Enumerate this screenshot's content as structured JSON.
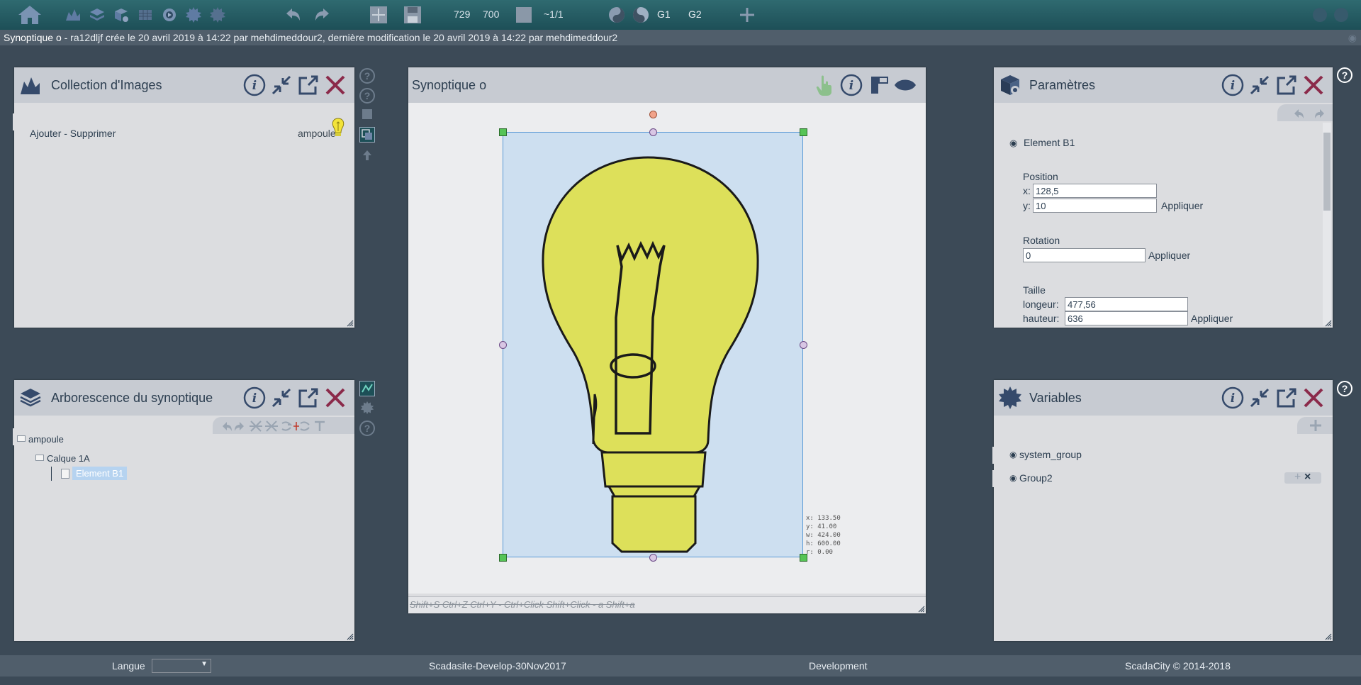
{
  "topbar": {
    "num1": "729",
    "num2": "700",
    "page": "~1/1",
    "g1": "G1",
    "g2": "G2"
  },
  "infobar": {
    "title": "Synoptique o",
    "meta": " - ra12dljf crée le 20 avril 2019 à 14:22 par mehdimeddour2, dernière modification le 20 avril 2019 à 14:22 par mehdimeddour2"
  },
  "collection": {
    "title": "Collection d'Images",
    "add_remove": "Ajouter - Supprimer",
    "item_name": "ampoule"
  },
  "tree": {
    "title": "Arborescence du synoptique",
    "root": "ampoule",
    "layer": "Calque 1A",
    "element": "Element B1"
  },
  "synoptique": {
    "title": "Synoptique o",
    "status": "Shift+S Ctrl+Z Ctrl+Y - Ctrl+Click Shift+Click - a Shift+a",
    "coords": [
      "x: 133.50",
      "y: 41.00",
      "w: 424.00",
      "h: 600.00",
      "r: 0.00"
    ]
  },
  "params": {
    "title": "Paramètres",
    "element": "Element B1",
    "position_label": "Position",
    "x_label": "x:",
    "x_value": "128,5",
    "y_label": "y:",
    "y_value": "10",
    "apply": "Appliquer",
    "rotation_label": "Rotation",
    "rotation_value": "0",
    "size_label": "Taille",
    "length_label": "longeur:",
    "length_value": "477,56",
    "height_label": "hauteur:",
    "height_value": "636"
  },
  "variables": {
    "title": "Variables",
    "items": [
      "system_group",
      "Group2"
    ]
  },
  "footer": {
    "lang_label": "Langue",
    "build": "Scadasite-Develop-30Nov2017",
    "env": "Development",
    "copyright": "ScadaCity © 2014-2018"
  },
  "colors": {
    "toolbar": "#1d4f57",
    "panel": "#dcdde0",
    "header": "#c7cbd2",
    "close": "#8b2a4a",
    "bulb": "#dde05a",
    "selection": "#cddff0"
  }
}
